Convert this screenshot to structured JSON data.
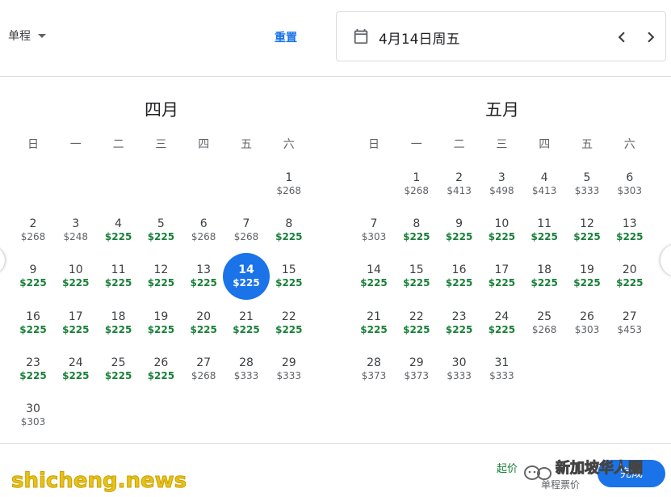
{
  "header": {
    "trip_type": "单程",
    "reset_label": "重置",
    "selected_date": "4月14日周五"
  },
  "weekdays": [
    "日",
    "一",
    "二",
    "三",
    "四",
    "五",
    "六"
  ],
  "months": [
    {
      "title": "四月",
      "first_weekday": 6,
      "days": [
        {
          "d": "1",
          "p": "$268",
          "low": false
        },
        {
          "d": "2",
          "p": "$268",
          "low": false
        },
        {
          "d": "3",
          "p": "$248",
          "low": false
        },
        {
          "d": "4",
          "p": "$225",
          "low": true
        },
        {
          "d": "5",
          "p": "$225",
          "low": true
        },
        {
          "d": "6",
          "p": "$268",
          "low": false
        },
        {
          "d": "7",
          "p": "$268",
          "low": false
        },
        {
          "d": "8",
          "p": "$225",
          "low": true
        },
        {
          "d": "9",
          "p": "$225",
          "low": true
        },
        {
          "d": "10",
          "p": "$225",
          "low": true
        },
        {
          "d": "11",
          "p": "$225",
          "low": true
        },
        {
          "d": "12",
          "p": "$225",
          "low": true
        },
        {
          "d": "13",
          "p": "$225",
          "low": true
        },
        {
          "d": "14",
          "p": "$225",
          "low": true,
          "selected": true
        },
        {
          "d": "15",
          "p": "$225",
          "low": true
        },
        {
          "d": "16",
          "p": "$225",
          "low": true
        },
        {
          "d": "17",
          "p": "$225",
          "low": true
        },
        {
          "d": "18",
          "p": "$225",
          "low": true
        },
        {
          "d": "19",
          "p": "$225",
          "low": true
        },
        {
          "d": "20",
          "p": "$225",
          "low": true
        },
        {
          "d": "21",
          "p": "$225",
          "low": true
        },
        {
          "d": "22",
          "p": "$225",
          "low": true
        },
        {
          "d": "23",
          "p": "$225",
          "low": true
        },
        {
          "d": "24",
          "p": "$225",
          "low": true
        },
        {
          "d": "25",
          "p": "$225",
          "low": true
        },
        {
          "d": "26",
          "p": "$225",
          "low": true
        },
        {
          "d": "27",
          "p": "$268",
          "low": false
        },
        {
          "d": "28",
          "p": "$333",
          "low": false
        },
        {
          "d": "29",
          "p": "$333",
          "low": false
        },
        {
          "d": "30",
          "p": "$303",
          "low": false
        }
      ]
    },
    {
      "title": "五月",
      "first_weekday": 1,
      "days": [
        {
          "d": "1",
          "p": "$268",
          "low": false
        },
        {
          "d": "2",
          "p": "$413",
          "low": false
        },
        {
          "d": "3",
          "p": "$498",
          "low": false
        },
        {
          "d": "4",
          "p": "$413",
          "low": false
        },
        {
          "d": "5",
          "p": "$333",
          "low": false
        },
        {
          "d": "6",
          "p": "$303",
          "low": false
        },
        {
          "d": "7",
          "p": "$303",
          "low": false
        },
        {
          "d": "8",
          "p": "$225",
          "low": true
        },
        {
          "d": "9",
          "p": "$225",
          "low": true
        },
        {
          "d": "10",
          "p": "$225",
          "low": true
        },
        {
          "d": "11",
          "p": "$225",
          "low": true
        },
        {
          "d": "12",
          "p": "$225",
          "low": true
        },
        {
          "d": "13",
          "p": "$225",
          "low": true
        },
        {
          "d": "14",
          "p": "$225",
          "low": true
        },
        {
          "d": "15",
          "p": "$225",
          "low": true
        },
        {
          "d": "16",
          "p": "$225",
          "low": true
        },
        {
          "d": "17",
          "p": "$225",
          "low": true
        },
        {
          "d": "18",
          "p": "$225",
          "low": true
        },
        {
          "d": "19",
          "p": "$225",
          "low": true
        },
        {
          "d": "20",
          "p": "$225",
          "low": true
        },
        {
          "d": "21",
          "p": "$225",
          "low": true
        },
        {
          "d": "22",
          "p": "$225",
          "low": true
        },
        {
          "d": "23",
          "p": "$225",
          "low": true
        },
        {
          "d": "24",
          "p": "$225",
          "low": true
        },
        {
          "d": "25",
          "p": "$268",
          "low": false
        },
        {
          "d": "26",
          "p": "$303",
          "low": false
        },
        {
          "d": "27",
          "p": "$453",
          "low": false
        },
        {
          "d": "28",
          "p": "$373",
          "low": false
        },
        {
          "d": "29",
          "p": "$373",
          "low": false
        },
        {
          "d": "30",
          "p": "$333",
          "low": false
        },
        {
          "d": "31",
          "p": "$333",
          "low": false
        }
      ]
    }
  ],
  "footer": {
    "from_price": "起价",
    "price_type": "单程票价",
    "done_label": "完成"
  },
  "watermarks": {
    "overlay_text": "新加坡华人圈",
    "site": "shicheng.news"
  },
  "colors": {
    "accent": "#1a73e8",
    "low_price": "#188038",
    "text": "#3c4043",
    "muted": "#5f6368",
    "divider": "#dadce0"
  },
  "icons": {
    "date": "calendar-icon",
    "prev": "chevron-left-icon",
    "next": "chevron-right-icon",
    "trip_dropdown": "caret-down-icon"
  }
}
